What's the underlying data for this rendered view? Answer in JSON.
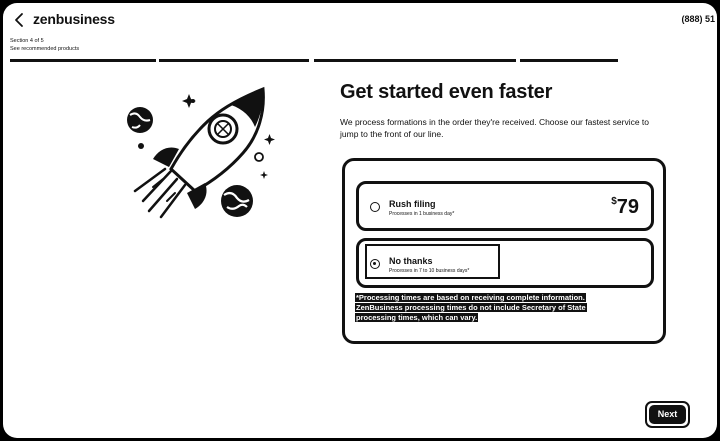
{
  "header": {
    "logo": "zenbusiness",
    "phone": "(888) 51",
    "section_label": "Section 4 of 5",
    "section_sub": "See recommended products"
  },
  "progress": {
    "total_steps": 4,
    "completed_steps": 4
  },
  "main": {
    "title": "Get started even faster",
    "description": "We process formations in the order they're received. Choose our fastest service to jump to the front of our line."
  },
  "options": {
    "rush": {
      "title": "Rush filing",
      "subtitle": "Processes in 1 business day*",
      "currency": "$",
      "price": "79",
      "selected": false
    },
    "no_thanks": {
      "title": "No thanks",
      "subtitle": "Processes in 7 to 10 business days*",
      "selected": true
    }
  },
  "disclaimer": "*Processing times are based on receiving complete information. ZenBusiness processing times do not include Secretary of State processing times, which can vary.",
  "footer": {
    "next_label": "Next"
  },
  "icons": {
    "back": "back-arrow-icon",
    "illustration": "rocket-illustration"
  }
}
